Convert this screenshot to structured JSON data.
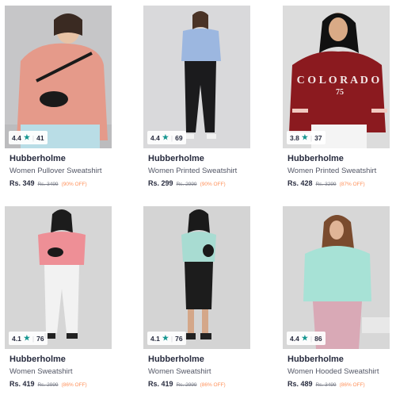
{
  "products": [
    {
      "brand": "Hubberholme",
      "title": "Women Pullover Sweatshirt",
      "rating": "4.4",
      "reviews": "41",
      "price": "Rs. 349",
      "mrp": "Rs. 3499",
      "discount": "(90% OFF)",
      "bg": "#c6c6c8",
      "top": "#e59a8a",
      "bottom": "#b9dde6"
    },
    {
      "brand": "Hubberholme",
      "title": "Women Printed Sweatshirt",
      "rating": "4.4",
      "reviews": "69",
      "price": "Rs. 299",
      "mrp": "Rs. 2999",
      "discount": "(90% OFF)",
      "bg": "#d9d9db",
      "top": "#9cb7e0",
      "bottom": "#1b1b1d"
    },
    {
      "brand": "Hubberholme",
      "title": "Women Printed Sweatshirt",
      "rating": "3.8",
      "reviews": "37",
      "price": "Rs. 428",
      "mrp": "Rs. 3299",
      "discount": "(87% OFF)",
      "bg": "#dcdcdc",
      "top": "#8b1a1f",
      "bottom": "#f4f4f4",
      "print": "COLORADO"
    },
    {
      "brand": "Hubberholme",
      "title": "Women Sweatshirt",
      "rating": "4.1",
      "reviews": "76",
      "price": "Rs. 419",
      "mrp": "Rs. 2999",
      "discount": "(86% OFF)",
      "bg": "#d6d6d6",
      "top": "#ee8f96",
      "bottom": "#f2f2f2"
    },
    {
      "brand": "Hubberholme",
      "title": "Women Sweatshirt",
      "rating": "4.1",
      "reviews": "76",
      "price": "Rs. 419",
      "mrp": "Rs. 2999",
      "discount": "(86% OFF)",
      "bg": "#d4d4d4",
      "top": "#a8dcd2",
      "bottom": "#1c1c1c"
    },
    {
      "brand": "Hubberholme",
      "title": "Women Hooded Sweatshirt",
      "rating": "4.4",
      "reviews": "86",
      "price": "Rs. 489",
      "mrp": "Rs. 3499",
      "discount": "(86% OFF)",
      "bg": "#d7d7d7",
      "top": "#a7e2d6",
      "bottom": "#d9a9b6"
    }
  ],
  "colors": {
    "accent_star": "#14958f",
    "discount": "#ff905a"
  }
}
